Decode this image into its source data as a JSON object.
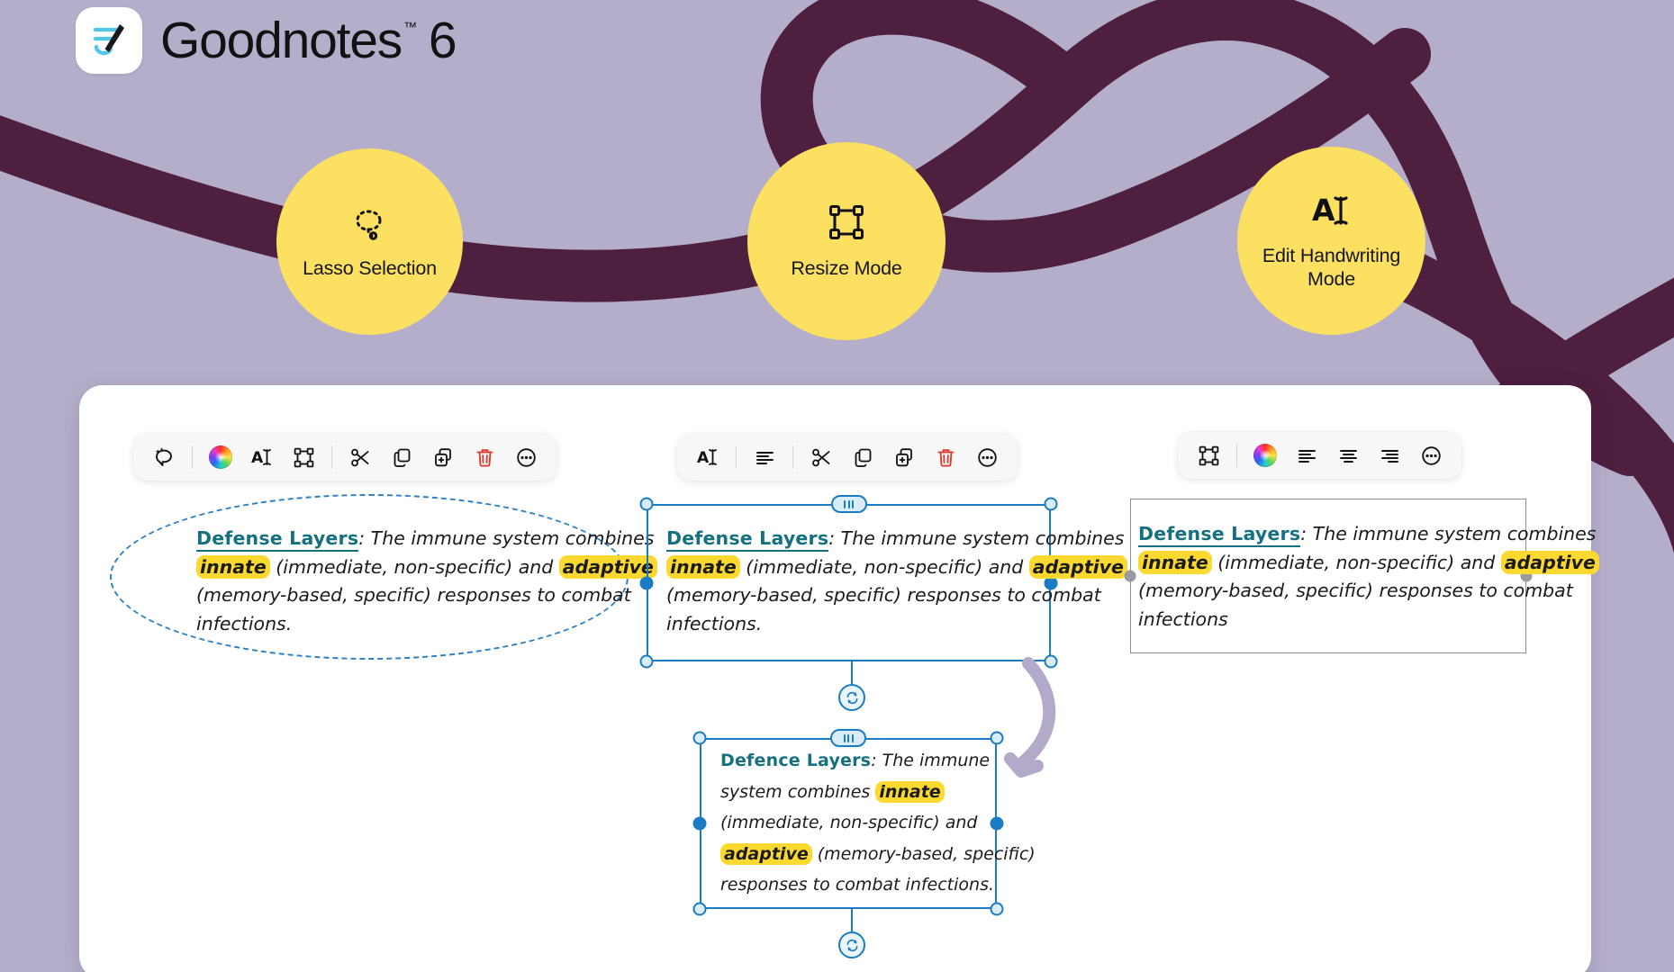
{
  "brand": {
    "name": "Goodnotes",
    "version": "6",
    "trademark": "™",
    "logo_icon": "goodnotes-pen-logo",
    "logo_line_color": "#4ec8e8",
    "logo_pen_color": "#1a1a1a"
  },
  "theme": {
    "background": "#b5aecb",
    "swoosh": "#4e1f3f",
    "badge_yellow": "#fbe062",
    "card_white": "#ffffff",
    "selection_blue": "#1b7cc4",
    "title_teal": "#15707f",
    "highlight_yellow": "#fcd930",
    "arrow_purple": "#b3a9c8",
    "trash_red": "#e0342c",
    "gray_frame": "#8d8d93"
  },
  "badges": [
    {
      "id": "lasso-selection",
      "label": "Lasso Selection",
      "icon": "lasso-sparkle-icon"
    },
    {
      "id": "resize-mode",
      "label": "Resize Mode",
      "icon": "resize-box-icon"
    },
    {
      "id": "edit-handwriting-mode",
      "label": "Edit Handwriting Mode",
      "icon": "handwriting-cursor-icon"
    }
  ],
  "toolbars": {
    "lasso": {
      "name": "lasso-toolbar",
      "items": [
        {
          "icon": "lasso-sparkle-icon",
          "label": "Lasso"
        },
        {
          "icon": "separator",
          "label": ""
        },
        {
          "icon": "color-wheel-icon",
          "label": "Color"
        },
        {
          "icon": "handwriting-cursor-icon",
          "label": "Edit Handwriting"
        },
        {
          "icon": "resize-box-icon",
          "label": "Resize"
        },
        {
          "icon": "separator",
          "label": ""
        },
        {
          "icon": "scissors-icon",
          "label": "Cut"
        },
        {
          "icon": "copy-icon",
          "label": "Copy"
        },
        {
          "icon": "duplicate-icon",
          "label": "Duplicate"
        },
        {
          "icon": "trash-icon",
          "label": "Delete"
        },
        {
          "icon": "more-icon",
          "label": "More"
        }
      ]
    },
    "resize": {
      "name": "resize-toolbar",
      "items": [
        {
          "icon": "handwriting-cursor-icon",
          "label": "Edit Handwriting"
        },
        {
          "icon": "separator",
          "label": ""
        },
        {
          "icon": "align-left-icon",
          "label": "Align Left"
        },
        {
          "icon": "separator",
          "label": ""
        },
        {
          "icon": "scissors-icon",
          "label": "Cut"
        },
        {
          "icon": "copy-icon",
          "label": "Copy"
        },
        {
          "icon": "duplicate-icon",
          "label": "Duplicate"
        },
        {
          "icon": "trash-icon",
          "label": "Delete"
        },
        {
          "icon": "more-icon",
          "label": "More"
        }
      ]
    },
    "text": {
      "name": "handwriting-toolbar",
      "items": [
        {
          "icon": "resize-box-icon",
          "label": "Resize"
        },
        {
          "icon": "separator",
          "label": ""
        },
        {
          "icon": "color-wheel-icon",
          "label": "Color"
        },
        {
          "icon": "align-left-icon",
          "label": "Align Left"
        },
        {
          "icon": "align-center-icon",
          "label": "Align Center"
        },
        {
          "icon": "align-right-icon",
          "label": "Align Right"
        },
        {
          "icon": "more-icon",
          "label": "More"
        }
      ]
    }
  },
  "notes": {
    "lasso": {
      "title": "Defense Layers",
      "colon": ":",
      "lines": [
        {
          "pre": " The immune system combines"
        },
        {
          "hl": "innate",
          "mid": " (immediate, non-specific) and ",
          "hl2": "adaptive"
        },
        {
          "pre": "(memory-based, specific) responses to combat"
        },
        {
          "pre": "infections."
        }
      ]
    },
    "resize": {
      "title": "Defense Layers",
      "colon": ":",
      "lines": [
        {
          "pre": " The immune system combines"
        },
        {
          "hl": "innate",
          "mid": " (immediate, non-specific) and ",
          "hl2": "adaptive"
        },
        {
          "pre": "(memory-based, specific) responses to combat"
        },
        {
          "pre": "infections."
        }
      ]
    },
    "text": {
      "title": "Defense Layers",
      "colon": ":",
      "lines": [
        {
          "pre": " The immune system combines"
        },
        {
          "hl": "innate",
          "mid": " (immediate, non-specific) and ",
          "hl2": "adaptive"
        },
        {
          "pre": "(memory-based, specific) responses to combat"
        },
        {
          "pre": "infections"
        }
      ]
    },
    "reflow": {
      "title": "Defence Layers",
      "colon": ":",
      "lines": [
        {
          "pre": " The immune"
        },
        {
          "pre": "system combines ",
          "hl": "innate"
        },
        {
          "pre": "(immediate, non-specific) and"
        },
        {
          "hl": "adaptive",
          "mid": " (memory-based, specific)"
        },
        {
          "pre": "responses to combat infections."
        }
      ]
    }
  },
  "handles": {
    "grip_icon": "drag-grip-handle",
    "sync_icon": "sync-refresh-icon",
    "arrow_icon": "curved-arrow-icon"
  }
}
